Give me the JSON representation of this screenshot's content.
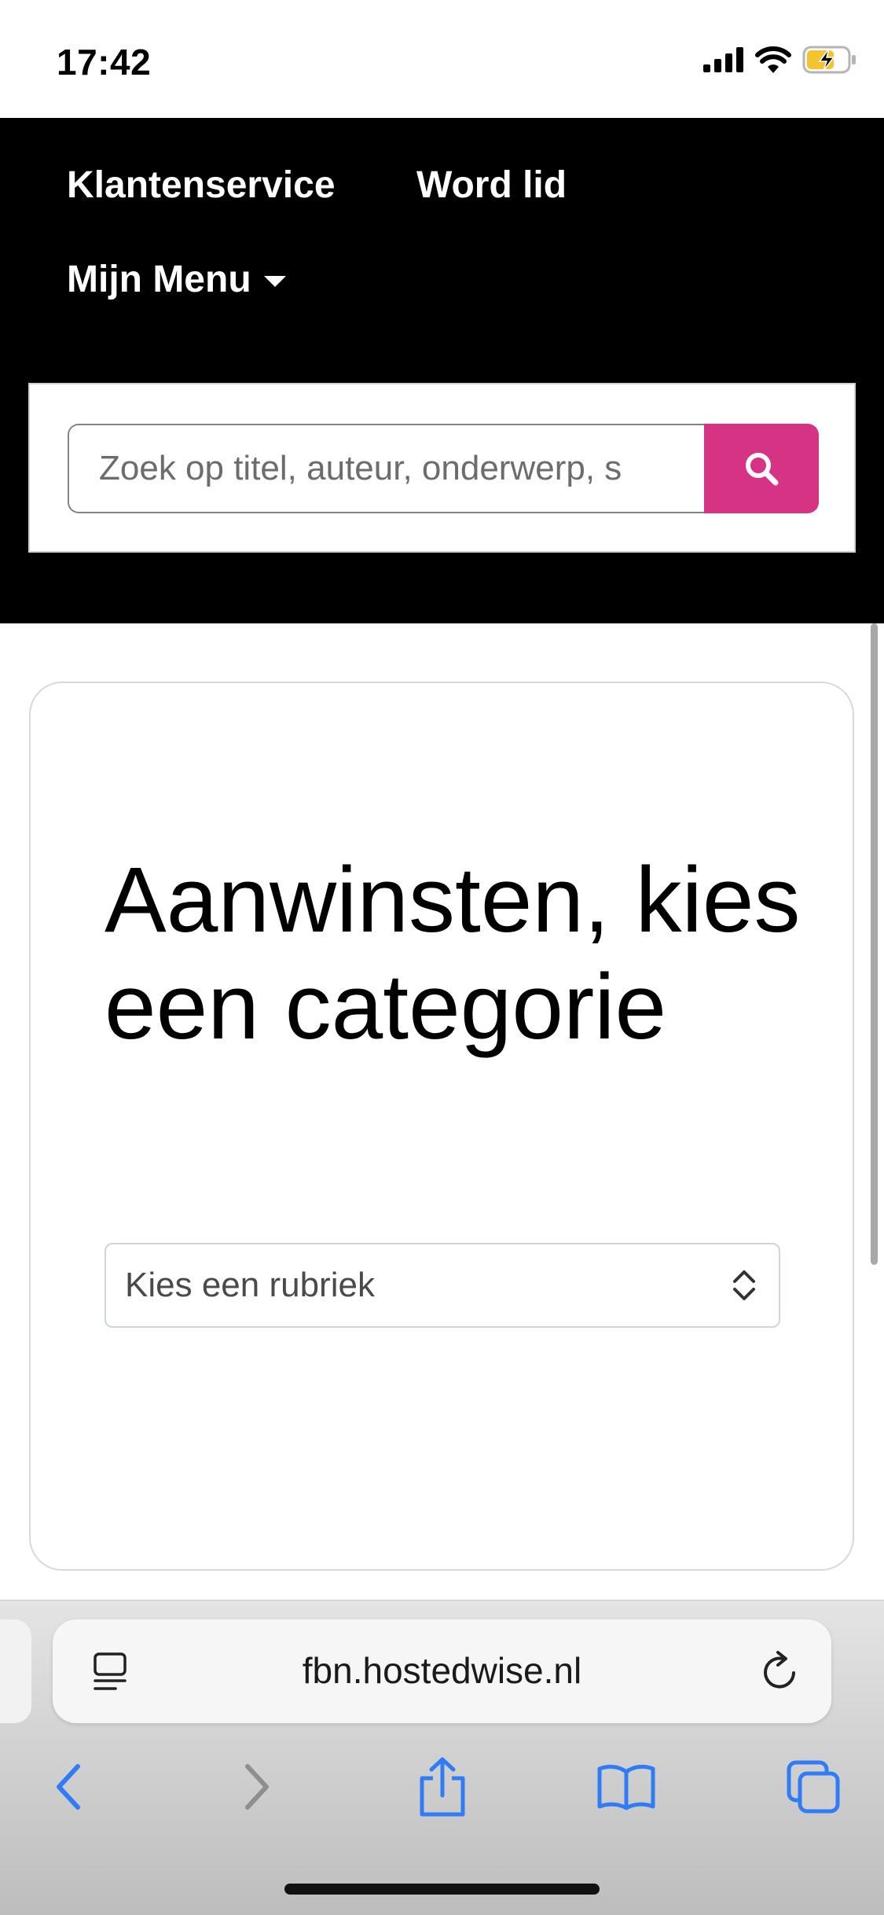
{
  "status_bar": {
    "time": "17:42"
  },
  "header": {
    "nav": {
      "klantenservice": "Klantenservice",
      "word_lid": "Word lid",
      "mijn_menu": "Mijn Menu"
    },
    "search": {
      "placeholder": "Zoek op titel, auteur, onderwerp, s"
    }
  },
  "main": {
    "title": "Aanwinsten, kies een categorie",
    "select": {
      "selected": "Kies een rubriek"
    }
  },
  "browser": {
    "url": "fbn.hostedwise.nl"
  },
  "colors": {
    "header_bg": "#000000",
    "search_button": "#d63384",
    "safari_accent": "#2f7cf6"
  },
  "icons": {
    "search": "search-icon",
    "caret": "caret-down-icon",
    "select": "chevron-up-down-icon",
    "reload": "reload-icon",
    "back": "chevron-left-icon",
    "forward": "chevron-right-icon",
    "share": "share-icon",
    "bookmarks": "book-icon",
    "tabs": "tabs-icon"
  }
}
